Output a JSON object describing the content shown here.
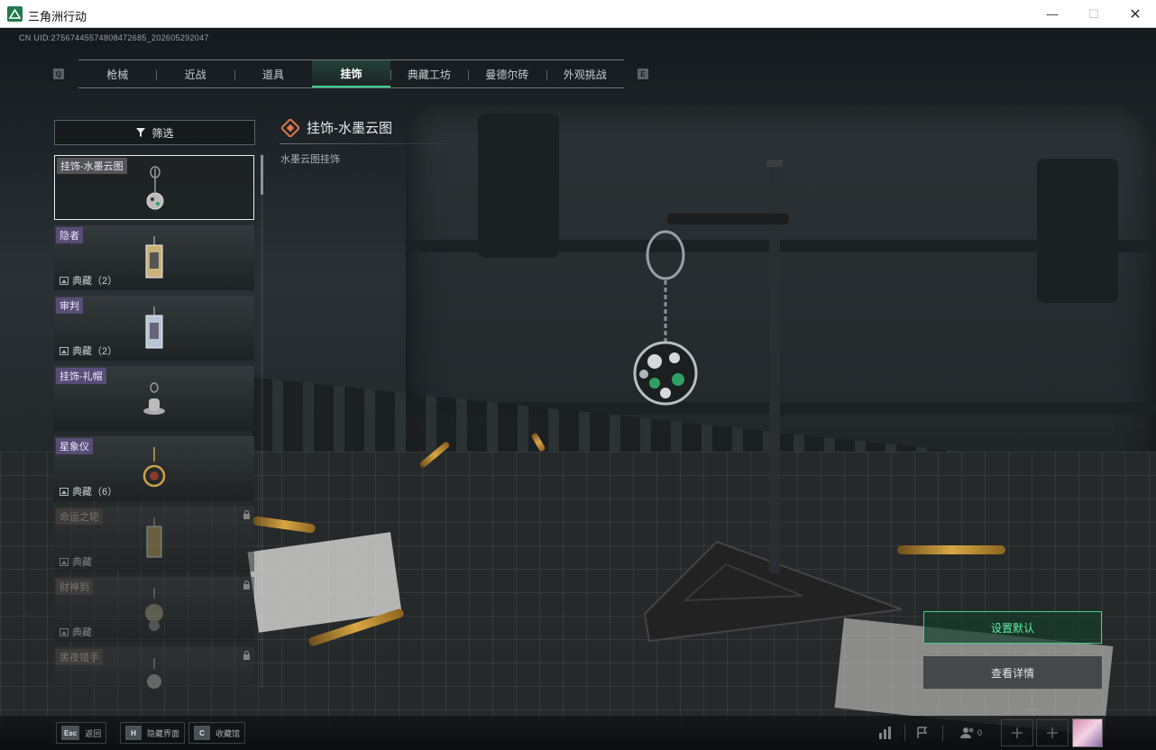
{
  "window": {
    "title": "三角洲行动",
    "controls": {
      "minimize": "—",
      "maximize": "☐",
      "close": "✕"
    }
  },
  "uid_text": "CN UID:27567445574808472685_202605292047",
  "tabs": [
    {
      "label": "枪械",
      "active": false
    },
    {
      "label": "近战",
      "active": false
    },
    {
      "label": "道具",
      "active": false
    },
    {
      "label": "挂饰",
      "active": true
    },
    {
      "label": "典藏工坊",
      "active": false
    },
    {
      "label": "曼德尔砖",
      "active": false
    },
    {
      "label": "外观挑战",
      "active": false
    }
  ],
  "tab_hints": {
    "left": "Q",
    "right": "E"
  },
  "filter": {
    "label": "筛选",
    "icon": "filter-icon"
  },
  "items": [
    {
      "name": "挂饰-水墨云图",
      "collection": "",
      "locked": false,
      "selected": true
    },
    {
      "name": "隐者",
      "collection": "典藏（2）",
      "locked": false,
      "selected": false
    },
    {
      "name": "审判",
      "collection": "典藏（2）",
      "locked": false,
      "selected": false
    },
    {
      "name": "挂饰-礼帽",
      "collection": "",
      "locked": false,
      "selected": false
    },
    {
      "name": "星象仪",
      "collection": "典藏（6）",
      "locked": false,
      "selected": false
    },
    {
      "name": "命运之轮",
      "collection": "典藏",
      "locked": true,
      "selected": false
    },
    {
      "name": "财神到",
      "collection": "典藏",
      "locked": true,
      "selected": false
    },
    {
      "name": "黑夜猎手",
      "collection": "",
      "locked": true,
      "selected": false
    }
  ],
  "detail": {
    "title": "挂饰-水墨云图",
    "description": "水墨云图挂饰"
  },
  "actions": {
    "set_default": "设置默认",
    "view_details": "查看详情"
  },
  "bottom_hints": [
    {
      "key": "Esc",
      "label": "返回"
    },
    {
      "key": "H",
      "label": "隐藏界面"
    },
    {
      "key": "C",
      "label": "收藏馆"
    }
  ],
  "bottom_right": {
    "friends_count": "0",
    "icons": [
      "stats-icon",
      "flag-icon",
      "friends-icon",
      "add-icon",
      "add-icon",
      "avatar"
    ]
  },
  "colors": {
    "accent": "#3fd08a",
    "rarity_purple": "#7860aa"
  }
}
